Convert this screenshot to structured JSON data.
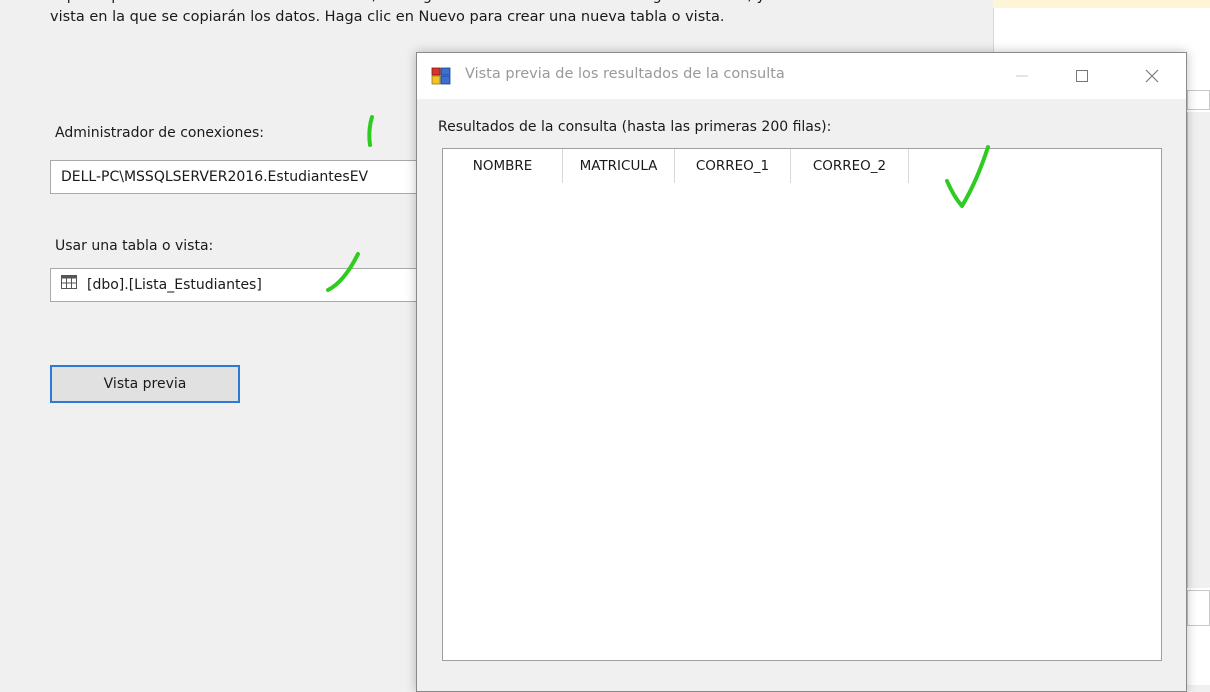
{
  "dialog": {
    "intro": "Especifique un administrador de conexiones, un origen de datos o una vista del origen de datos, y seleccione la tabla o vista en la que se copiarán los datos. Haga clic en Nuevo para crear una nueva tabla o vista.",
    "connection_label": "Administrador de conexiones:",
    "connection_value": "DELL-PC\\MSSQLSERVER2016.EstudiantesEV",
    "table_label": "Usar una tabla o vista:",
    "table_value": "[dbo].[Lista_Estudiantes]",
    "preview_button": "Vista previa"
  },
  "preview_window": {
    "title": "Vista previa de los resultados de la consulta",
    "results_label": "Resultados de la consulta (hasta las primeras 200 filas):",
    "columns": [
      "NOMBRE",
      "MATRICULA",
      "CORREO_1",
      "CORREO_2"
    ],
    "rows": []
  },
  "annotations": {
    "mark_color": "#2ecc1f"
  }
}
